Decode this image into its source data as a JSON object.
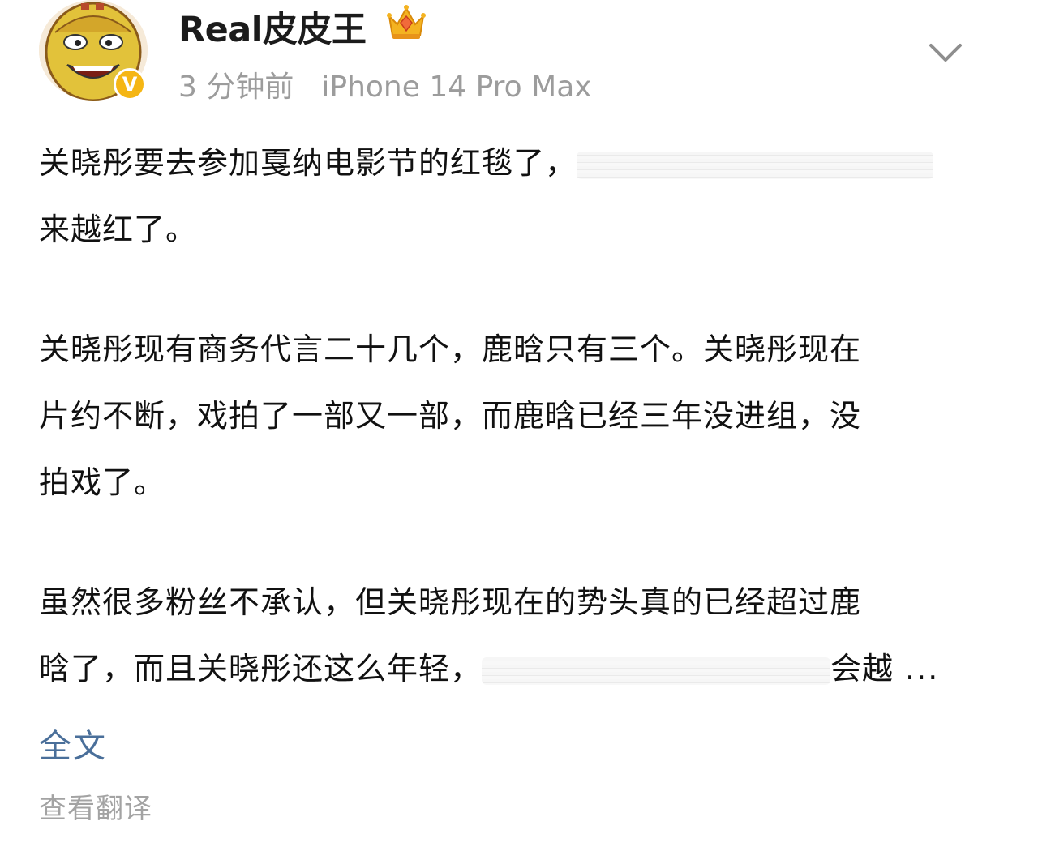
{
  "post": {
    "username": "Real皮皮王",
    "time": "3 分钟前",
    "device": "iPhone 14 Pro Max",
    "verified_mark": "V",
    "icons": {
      "avatar": "cartoon-avatar",
      "badge": "verified-badge-icon",
      "crown": "crown-icon",
      "menu": "chevron-down-icon"
    },
    "colors": {
      "badge": "#f5b614",
      "link": "#4a6f9a",
      "meta": "#9c9c9c"
    },
    "paragraphs": [
      {
        "lines": [
          {
            "text": "关晓彤要去参加戛纳电影节的红毯了，",
            "redacted_tail": true
          },
          {
            "text": "来越红了。"
          }
        ]
      },
      {
        "lines": [
          {
            "text": "关晓彤现有商务代言二十几个，鹿晗只有三个。关晓彤现在"
          },
          {
            "text": "片约不断，戏拍了一部又一部，而鹿晗已经三年没进组，没"
          },
          {
            "text": "拍戏了。"
          }
        ]
      },
      {
        "lines": [
          {
            "text": "虽然很多粉丝不承认，但关晓彤现在的势头真的已经超过鹿"
          },
          {
            "text": "晗了，而且关晓彤还这么年轻，",
            "redacted_middle": true,
            "after_redaction": "会越",
            "ellipsis": "..."
          }
        ]
      }
    ],
    "full_text_link": "全文",
    "translate_link": "查看翻译"
  }
}
